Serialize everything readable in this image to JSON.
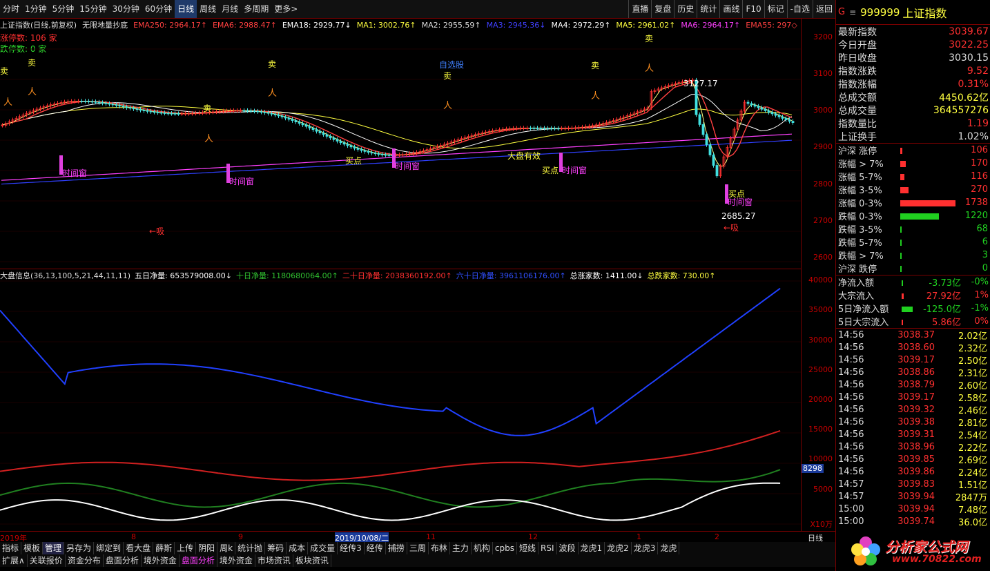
{
  "toolbar": {
    "periods": [
      "分时",
      "1分钟",
      "5分钟",
      "15分钟",
      "30分钟",
      "60分钟",
      "日线",
      "周线",
      "月线",
      "多周期",
      "更多>"
    ],
    "selected_period": "日线",
    "right": [
      "直播",
      "复盘",
      "历史",
      "统计",
      "画线",
      "F10",
      "标记",
      "-自选",
      "返回"
    ]
  },
  "main": {
    "title": "上证指数(日线,前复权)",
    "formula": "无限地量抄底",
    "indicators": [
      {
        "text": "EMA250: 2964.17↑",
        "color": "#ff4040"
      },
      {
        "text": "EMA6: 2988.47↑",
        "color": "#ff4040"
      },
      {
        "text": "EMA18: 2929.77↓",
        "color": "#ffffff"
      },
      {
        "text": "MA1: 3002.76↑",
        "color": "#ffff40"
      },
      {
        "text": "MA2: 2955.59↑",
        "color": "#dddddd"
      },
      {
        "text": "MA3: 2945.36↓",
        "color": "#4040ff"
      },
      {
        "text": "MA4: 2972.29↑",
        "color": "#ffffff"
      },
      {
        "text": "MA5: 2961.02↑",
        "color": "#ffff40"
      },
      {
        "text": "MA6: 2964.17↑",
        "color": "#ff40ff"
      },
      {
        "text": "EMA55: 297◇",
        "color": "#ff4040"
      }
    ],
    "zt": "涨停数: 106 家",
    "dt": "跌停数: 0 家",
    "yaxis": [
      "3200",
      "3100",
      "3000",
      "2900",
      "2800",
      "2700",
      "2600"
    ],
    "labels": {
      "sell": "卖",
      "buy": "买点",
      "window": "时间窗",
      "absorb": "←吸",
      "zixuan": "自选股",
      "high": "3127.17",
      "low": "2685.27",
      "hot": "大盘有效"
    }
  },
  "sub": {
    "title": "大盘信息(36,13,100,5,21,44,11,11)",
    "items": [
      {
        "text": "五日净量: 653579008.00↓",
        "color": "#ffffff"
      },
      {
        "text": "十日净量: 1180680064.00↑",
        "color": "#30c030"
      },
      {
        "text": "二十日净量: 2038360192.00↑",
        "color": "#ff3030"
      },
      {
        "text": "六十日净量: 3961106176.00↑",
        "color": "#3050ff"
      },
      {
        "text": "总涨家数: 1411.00↓",
        "color": "#ffffff"
      },
      {
        "text": "总跌家数: 730.00↑",
        "color": "#ffff40"
      }
    ],
    "yaxis": [
      "40000",
      "35000",
      "30000",
      "25000",
      "20000",
      "15000",
      "10000",
      "5000"
    ],
    "unit": "X10万",
    "marker": "8298"
  },
  "timeaxis": {
    "labels": [
      "2019年",
      "8",
      "9",
      "2019/10/08/二",
      "11",
      "12",
      "1",
      "2"
    ],
    "period": "日线"
  },
  "tabs1": [
    "指标",
    "模板",
    "管理",
    "另存为",
    "绑定到",
    "看大盘",
    "薛斯",
    "上传",
    "阴阳",
    "周k",
    "统计抛",
    "筹码",
    "成本",
    "成交量",
    "经传3",
    "经传",
    "捕捞",
    "三周",
    "布林",
    "主力",
    "机构",
    "cpbs",
    "短线",
    "RSI",
    "波段",
    "龙虎1",
    "龙虎2",
    "龙虎3",
    "龙虎"
  ],
  "tabs2": [
    "扩展∧",
    "关联报价",
    "资金分布",
    "盘面分析",
    "境外资金",
    "盘面分析",
    "境外资金",
    "市场资讯",
    "板块资讯"
  ],
  "right": {
    "flag": "G",
    "code": "999999",
    "name": "上证指数",
    "quote": [
      {
        "label": "最新指数",
        "value": "3039.67",
        "color": "#ff3030"
      },
      {
        "label": "今日开盘",
        "value": "3022.25",
        "color": "#ff3030"
      },
      {
        "label": "昨日收盘",
        "value": "3030.15",
        "color": "#dddddd"
      },
      {
        "label": "指数涨跌",
        "value": "9.52",
        "color": "#ff3030"
      },
      {
        "label": "指数涨幅",
        "value": "0.31%",
        "color": "#ff3030"
      },
      {
        "label": "总成交额",
        "value": "4450.62亿",
        "color": "#ffff40"
      },
      {
        "label": "总成交量",
        "value": "364557276",
        "color": "#ffff40"
      },
      {
        "label": "指数量比",
        "value": "1.19",
        "color": "#ff3030"
      },
      {
        "label": "上证换手",
        "value": "1.02%",
        "color": "#dddddd"
      }
    ],
    "dist": [
      {
        "label": "沪深 涨停",
        "value": "106",
        "frac": 0.04,
        "color": "#ff3030"
      },
      {
        "label": "涨幅 > 7%",
        "value": "170",
        "frac": 0.1,
        "color": "#ff3030"
      },
      {
        "label": "涨幅 5-7%",
        "value": "116",
        "frac": 0.07,
        "color": "#ff3030"
      },
      {
        "label": "涨幅 3-5%",
        "value": "270",
        "frac": 0.15,
        "color": "#ff3030"
      },
      {
        "label": "涨幅 0-3%",
        "value": "1738",
        "frac": 1.0,
        "color": "#ff3030"
      },
      {
        "label": "跌幅 0-3%",
        "value": "1220",
        "frac": 0.7,
        "color": "#20d020"
      },
      {
        "label": "跌幅 3-5%",
        "value": "68",
        "frac": 0.03,
        "color": "#20d020"
      },
      {
        "label": "跌幅 5-7%",
        "value": "6",
        "frac": 0.01,
        "color": "#20d020"
      },
      {
        "label": "跌幅 > 7%",
        "value": "3",
        "frac": 0.01,
        "color": "#20d020"
      },
      {
        "label": "沪深 跌停",
        "value": "0",
        "frac": 0,
        "color": "#20d020"
      }
    ],
    "flow": [
      {
        "label": "净流入额",
        "value": "-3.73亿",
        "pct": "-0%",
        "frac": 0.02,
        "color": "#20d020"
      },
      {
        "label": "大宗流入",
        "value": "27.92亿",
        "pct": "1%",
        "frac": 0.1,
        "color": "#ff3030"
      },
      {
        "label": "5日净流入额",
        "value": "-125.0亿",
        "pct": "-1%",
        "frac": 0.6,
        "color": "#20d020"
      },
      {
        "label": "5日大宗流入",
        "value": "5.86亿",
        "pct": "0%",
        "frac": 0.05,
        "color": "#ff3030"
      }
    ],
    "ticks": [
      [
        "14:56",
        "3038.37",
        "2.02亿"
      ],
      [
        "14:56",
        "3038.60",
        "2.32亿"
      ],
      [
        "14:56",
        "3039.17",
        "2.50亿"
      ],
      [
        "14:56",
        "3038.86",
        "2.31亿"
      ],
      [
        "14:56",
        "3038.79",
        "2.60亿"
      ],
      [
        "14:56",
        "3039.17",
        "2.58亿"
      ],
      [
        "14:56",
        "3039.32",
        "2.46亿"
      ],
      [
        "14:56",
        "3039.38",
        "2.81亿"
      ],
      [
        "14:56",
        "3039.31",
        "2.54亿"
      ],
      [
        "14:56",
        "3038.96",
        "2.22亿"
      ],
      [
        "14:56",
        "3039.85",
        "2.69亿"
      ],
      [
        "14:56",
        "3039.86",
        "2.24亿"
      ],
      [
        "14:57",
        "3039.83",
        "1.51亿"
      ],
      [
        "14:57",
        "3039.94",
        "2847万"
      ],
      [
        "15:00",
        "3039.94",
        "7.48亿"
      ],
      [
        "15:00",
        "3039.74",
        "36.0亿"
      ]
    ]
  },
  "watermark": {
    "text": "分析家公式网",
    "url": "www.70822.com"
  }
}
